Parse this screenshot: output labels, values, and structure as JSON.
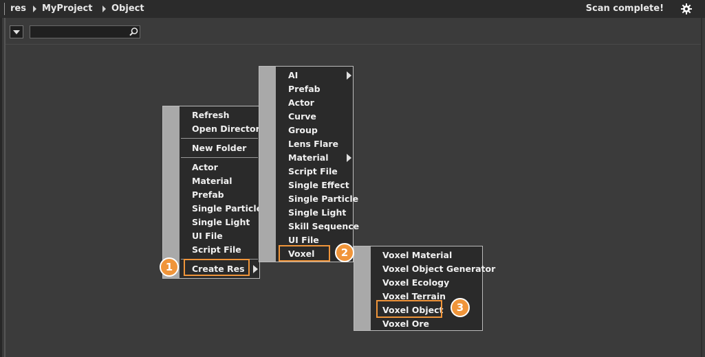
{
  "breadcrumb": {
    "items": [
      "res",
      "MyProject",
      "Object"
    ]
  },
  "status": "Scan complete!",
  "search": {
    "value": "",
    "placeholder": ""
  },
  "icons": {
    "dropdown": "dropdown-triangle-icon",
    "search": "magnifier-icon",
    "settings": "gear-icon",
    "submenu": "submenu-arrow-icon"
  },
  "colors": {
    "background": "#3b3b3b",
    "topbar": "#2b2b2b",
    "menu_bg": "#2a2a2a",
    "menu_gutter": "#a9a9a9",
    "highlight": "#f0953a"
  },
  "context_menu": {
    "group1": [
      "Refresh",
      "Open Directory"
    ],
    "group2": [
      "New Folder"
    ],
    "group3": [
      "Actor",
      "Material",
      "Prefab",
      "Single Particle",
      "Single Light",
      "UI File",
      "Script File"
    ],
    "create_res": "Create Res"
  },
  "create_res_menu": {
    "items": [
      "AI",
      "Prefab",
      "Actor",
      "Curve",
      "Group",
      "Lens Flare",
      "Material",
      "Script File",
      "Single Effect",
      "Single Particle",
      "Single Light",
      "Skill Sequence",
      "UI File",
      "Voxel"
    ]
  },
  "voxel_menu": {
    "items": [
      "Voxel Material",
      "Voxel Object Generator",
      "Voxel Ecology",
      "Voxel Terrain",
      "Voxel Object",
      "Voxel Ore"
    ]
  },
  "steps": [
    "1",
    "2",
    "3"
  ]
}
